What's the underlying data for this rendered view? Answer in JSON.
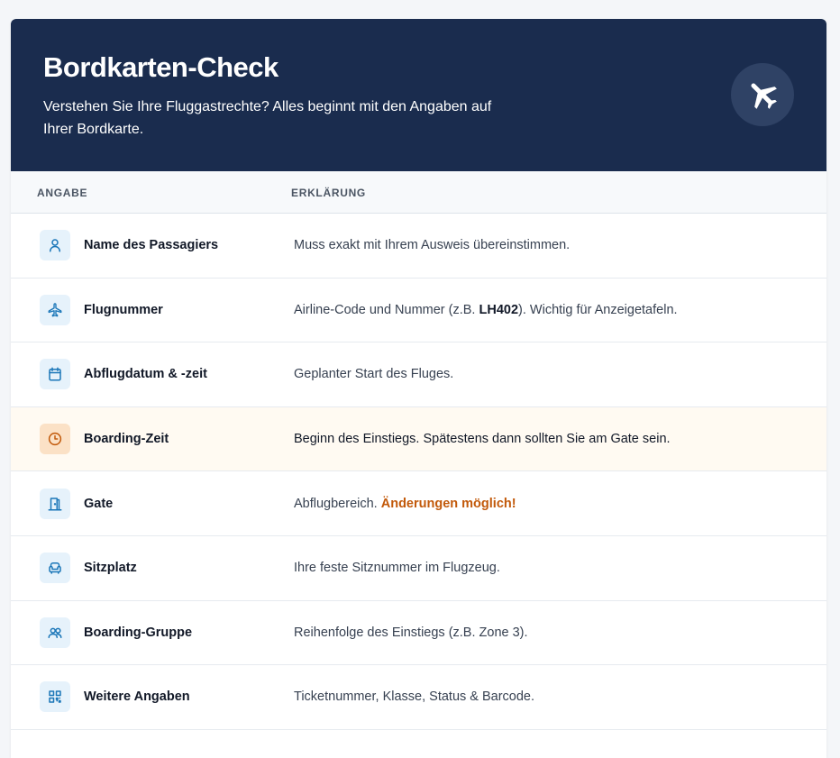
{
  "header": {
    "title": "Bordkarten-Check",
    "subtitle": "Verstehen Sie Ihre Fluggastrechte? Alles beginnt mit den Angaben auf Ihrer Bordkarte.",
    "icon": "airplane-icon"
  },
  "columns": {
    "field": "ANGABE",
    "explanation": "ERKLÄRUNG"
  },
  "colors": {
    "header_bg": "#1a2c4e",
    "accent": "#1a76b8",
    "highlight_bg": "#fffaf2",
    "warning": "#c2590a"
  },
  "rows": [
    {
      "icon": "user-icon",
      "label": "Name des Passagiers",
      "desc": "Muss exakt mit Ihrem Ausweis übereinstimmen."
    },
    {
      "icon": "plane-icon",
      "label": "Flugnummer",
      "desc_pre": "Airline-Code und Nummer (z.B. ",
      "desc_bold": "LH402",
      "desc_post": "). Wichtig für Anzeigetafeln."
    },
    {
      "icon": "calendar-icon",
      "label": "Abflugdatum & -zeit",
      "desc": "Geplanter Start des Fluges."
    },
    {
      "icon": "clock-icon",
      "label": "Boarding-Zeit",
      "desc": "Beginn des Einstiegs. Spätestens dann sollten Sie am Gate sein.",
      "highlighted": true
    },
    {
      "icon": "door-icon",
      "label": "Gate",
      "desc_pre": "Abflugbereich. ",
      "desc_warn": "Änderungen möglich!"
    },
    {
      "icon": "seat-icon",
      "label": "Sitzplatz",
      "desc": "Ihre feste Sitznummer im Flugzeug."
    },
    {
      "icon": "group-icon",
      "label": "Boarding-Gruppe",
      "desc": "Reihenfolge des Einstiegs (z.B. Zone 3)."
    },
    {
      "icon": "qr-code-icon",
      "label": "Weitere Angaben",
      "desc": "Ticketnummer, Klasse, Status & Barcode."
    }
  ]
}
